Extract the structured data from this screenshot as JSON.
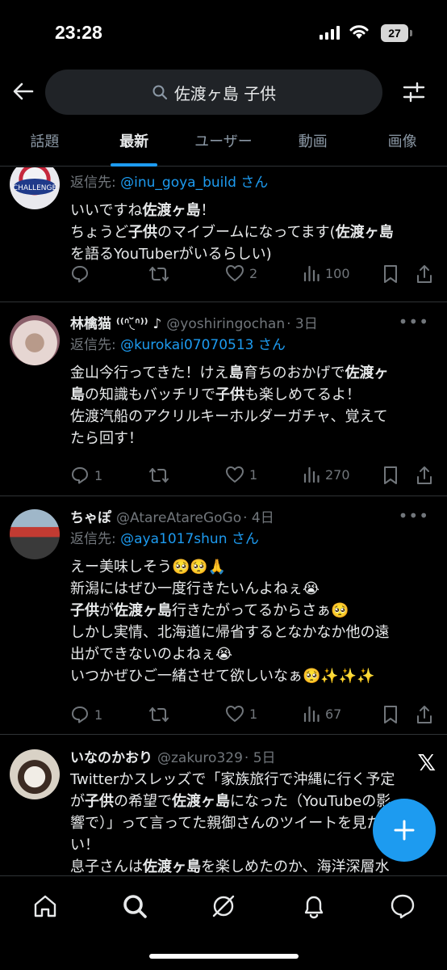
{
  "status_bar": {
    "time": "23:28",
    "battery": "27"
  },
  "search": {
    "query": "佐渡ヶ島 子供"
  },
  "tabs": [
    {
      "label": "話題",
      "active": false
    },
    {
      "label": "最新",
      "active": true
    },
    {
      "label": "ユーザー",
      "active": false
    },
    {
      "label": "動画",
      "active": false
    },
    {
      "label": "画像",
      "active": false
    }
  ],
  "posts": [
    {
      "reply_prefix": "返信先: ",
      "reply_to": "@inu_goya_build さん",
      "text_parts": [
        "いいですね",
        "佐渡ヶ島",
        "！\nちょうど",
        "子供",
        "のマイブームになってます(",
        "佐渡ヶ島",
        "\nを語るYouTuberがいるらしい)"
      ],
      "replies": "",
      "reposts": "",
      "likes": "2",
      "views": "100"
    },
    {
      "name": "林檎猫 ⁽⁽ᐢ◟̆ᐢ⁾⁾ ♪",
      "handle": "@yoshiringochan",
      "time": "· 3日",
      "reply_prefix": "返信先: ",
      "reply_to": "@kurokai07070513 さん",
      "text_parts": [
        "金山今行ってきた！けえ",
        "島",
        "育ちのおかげで",
        "佐渡ヶ\n島",
        "の知識もバッチリで",
        "子供",
        "も楽しめてるよ！\n佐渡汽船のアクリルキーホルダーガチャ、覚えて\nたら回す！"
      ],
      "replies": "1",
      "reposts": "",
      "likes": "1",
      "views": "270"
    },
    {
      "name": "ちゃぽ",
      "handle": "@AtareAtareGoGo",
      "time": "· 4日",
      "reply_prefix": "返信先: ",
      "reply_to": "@aya1017shun さん",
      "text_parts": [
        "えー美味しそう🥺🥺🙏\n新潟にはぜひ一度行きたいんよねぇ😭\n",
        "子供",
        "が",
        "佐渡ヶ島",
        "行きたがってるからさぁ🥺\nしかし実情、北海道に帰省するとなかなか他の遠\n出ができないのよねぇ😭\nいつかぜひご一緒させて欲しいなぁ🥺✨✨✨"
      ],
      "replies": "1",
      "reposts": "",
      "likes": "1",
      "views": "67"
    },
    {
      "name": "いなのかおり",
      "handle": "@zakuro329",
      "time": "· 5日",
      "text_parts": [
        "Twitterかスレッズで「家族旅行で沖縄に行く予定\nが",
        "子供",
        "の希望で",
        "佐渡ヶ島",
        "になった（YouTubeの影\n響で）」って言ってた親御さんのツイートを見た\nい！\n息子さんは",
        "佐渡ヶ島",
        "を楽しめたのか、海洋深層水"
      ]
    }
  ],
  "colors": {
    "accent": "#1d9bf0",
    "background": "#000000",
    "muted": "#71767b"
  }
}
